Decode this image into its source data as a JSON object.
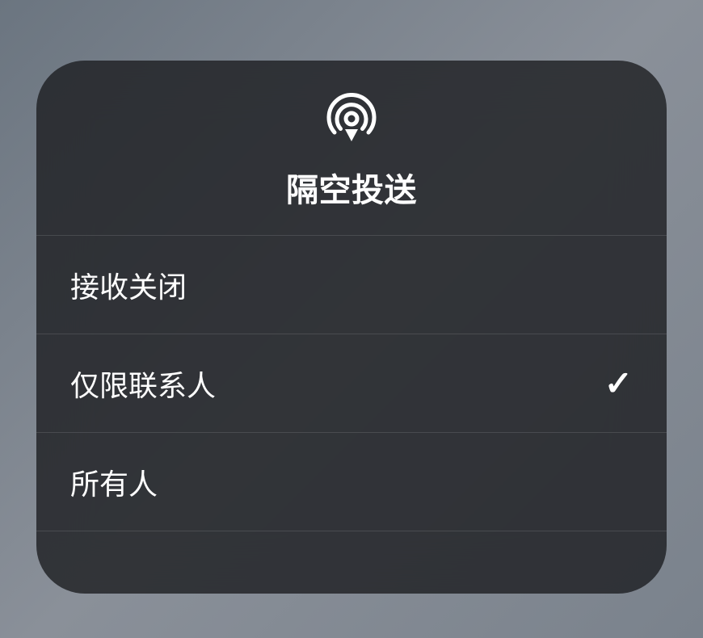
{
  "header": {
    "icon": "airdrop-icon",
    "title": "隔空投送"
  },
  "options": [
    {
      "label": "接收关闭",
      "selected": false
    },
    {
      "label": "仅限联系人",
      "selected": true
    },
    {
      "label": "所有人",
      "selected": false
    }
  ]
}
